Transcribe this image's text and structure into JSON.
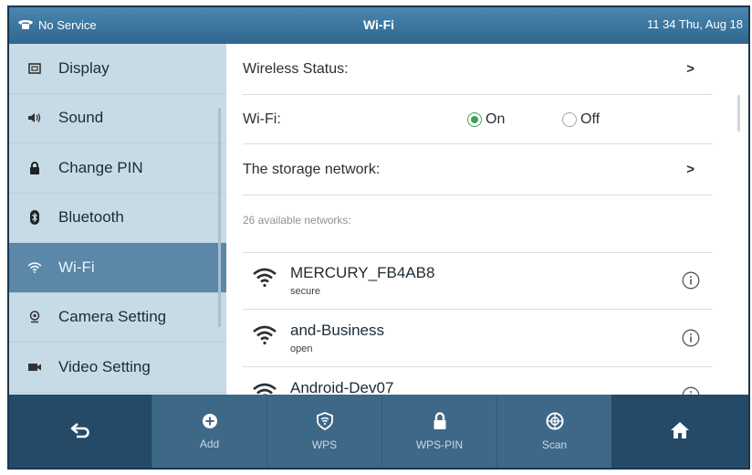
{
  "statusbar": {
    "service": "No Service",
    "title": "Wi-Fi",
    "datetime": "11 34 Thu, Aug 18"
  },
  "sidebar": {
    "items": [
      {
        "label": "Display",
        "icon": "display-icon"
      },
      {
        "label": "Sound",
        "icon": "speaker-icon"
      },
      {
        "label": "Change PIN",
        "icon": "lock-icon"
      },
      {
        "label": "Bluetooth",
        "icon": "bluetooth-icon"
      },
      {
        "label": "Wi-Fi",
        "icon": "wifi-icon",
        "active": true
      },
      {
        "label": "Camera Setting",
        "icon": "camera-icon"
      },
      {
        "label": "Video Setting",
        "icon": "video-icon"
      }
    ]
  },
  "main": {
    "wireless_status_label": "Wireless Status:",
    "wifi_label": "Wi-Fi:",
    "wifi_on_label": "On",
    "wifi_off_label": "Off",
    "wifi_state": "On",
    "storage_network_label": "The storage network:",
    "chevron": ">",
    "available_networks": "26 available networks:",
    "networks": [
      {
        "ssid": "MERCURY_FB4AB8",
        "security": "secure"
      },
      {
        "ssid": "and-Business",
        "security": "open"
      },
      {
        "ssid": "Android-Dev07",
        "security": ""
      }
    ]
  },
  "bottombar": {
    "back_icon": "back-arrow-icon",
    "add_label": "Add",
    "wps_label": "WPS",
    "wps_pin_label": "WPS-PIN",
    "scan_label": "Scan",
    "home_icon": "home-icon"
  },
  "colors": {
    "statusbar": "#3a76a0",
    "sidebar": "#c7dbe7",
    "sidebar_active": "#5b87a8",
    "bottombar": "#244a68",
    "radio_on": "#3aa35a"
  }
}
